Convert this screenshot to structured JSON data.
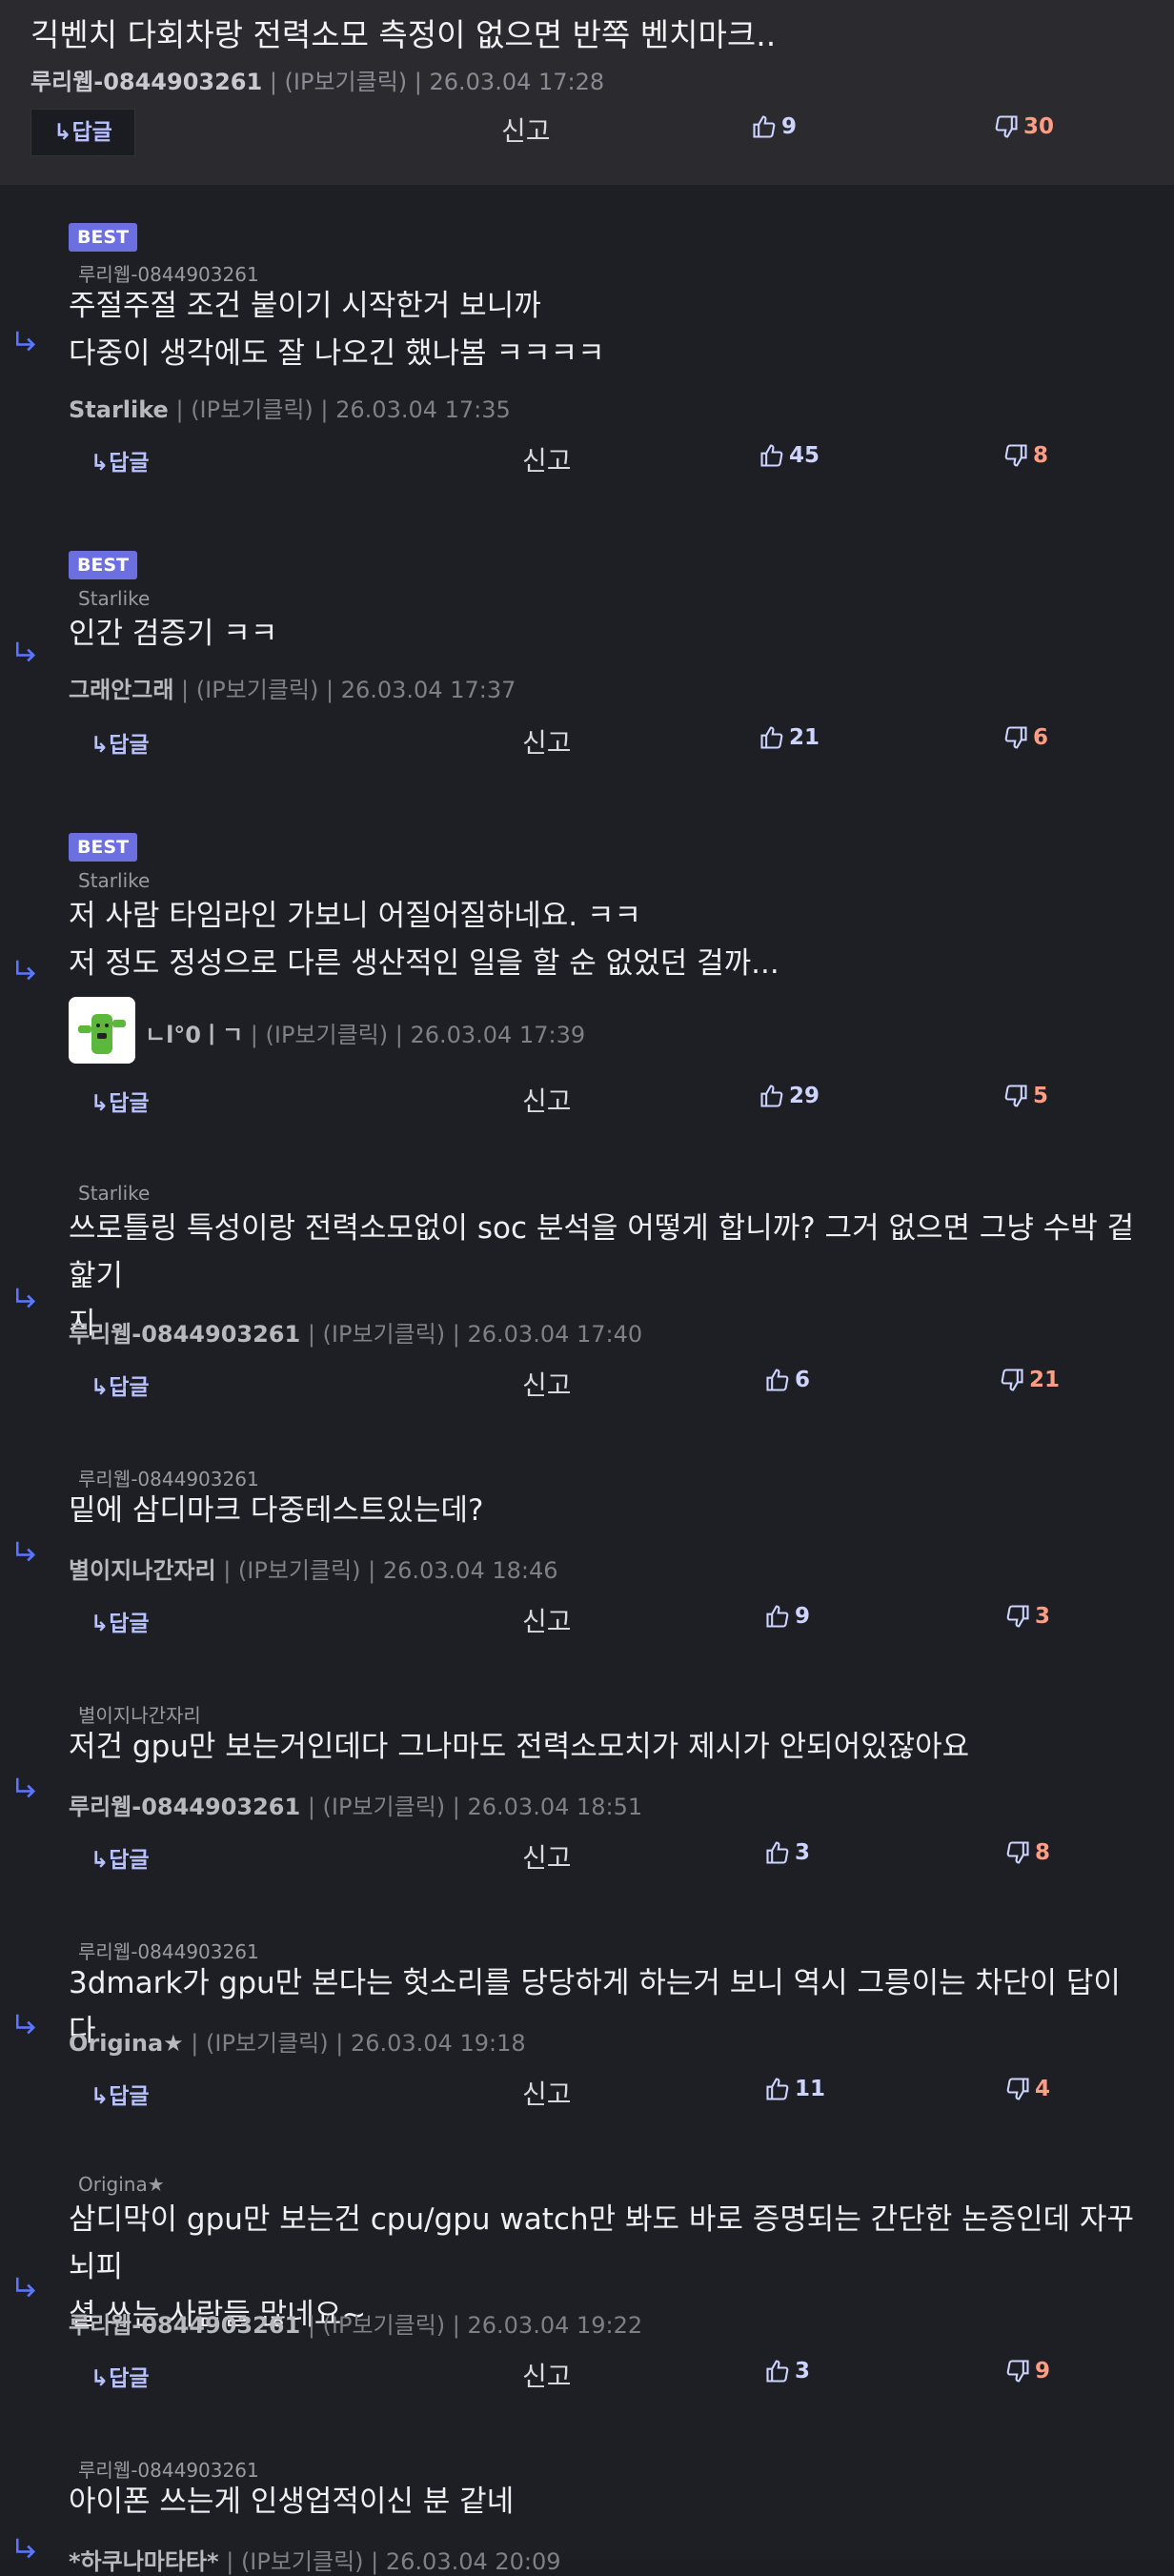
{
  "labels": {
    "reply": "↳답글",
    "report": "신고",
    "best": "BEST"
  },
  "top_comment": {
    "text": "긱벤치 다회차랑 전력소모 측정이 없으면 반쪽 벤치마크..",
    "author": "루리웹-0844903261",
    "meta": " | (IP보기클릭) | 26.03.04 17:28",
    "up": "9",
    "down": "30"
  },
  "comments": [
    {
      "best": true,
      "parent": "루리웹-0844903261",
      "lines": [
        "주절주절 조건 붙이기 시작한거 보니까",
        "다중이 생각에도 잘 나오긴 했나봄 ㅋㅋㅋㅋ"
      ],
      "author": "Starlike",
      "meta": " | (IP보기클릭) | 26.03.04 17:35",
      "up": "45",
      "down": "8"
    },
    {
      "best": true,
      "parent": "Starlike",
      "lines": [
        "인간 검증기 ㅋㅋ"
      ],
      "author": "그래안그래",
      "meta": " | (IP보기클릭) | 26.03.04 17:37",
      "up": "21",
      "down": "6"
    },
    {
      "best": true,
      "parent": "Starlike",
      "lines": [
        "저 사람 타임라인 가보니 어질어질하네요. ㅋㅋ",
        "저 정도 정성으로 다른 생산적인 일을 할 순 없었던 걸까..."
      ],
      "author": "ㄴl°0ㅣㄱ",
      "meta": " | (IP보기클릭) | 26.03.04 17:39",
      "up": "29",
      "down": "5"
    },
    {
      "best": false,
      "parent": "Starlike",
      "lines": [
        "쓰로틀링 특성이랑 전력소모없이 soc 분석을 어떻게 합니까? 그거 없으면 그냥 수박 겉핥기",
        "지"
      ],
      "author": "루리웹-0844903261",
      "meta": " | (IP보기클릭) | 26.03.04 17:40",
      "up": "6",
      "down": "21"
    },
    {
      "best": false,
      "parent": "루리웹-0844903261",
      "lines": [
        "밑에 삼디마크 다중테스트있는데?"
      ],
      "author": "별이지나간자리",
      "meta": " | (IP보기클릭) | 26.03.04 18:46",
      "up": "9",
      "down": "3"
    },
    {
      "best": false,
      "parent": "별이지나간자리",
      "lines": [
        "저건 gpu만 보는거인데다 그나마도 전력소모치가 제시가 안되어있잖아요"
      ],
      "author": "루리웹-0844903261",
      "meta": " | (IP보기클릭) | 26.03.04 18:51",
      "up": "3",
      "down": "8"
    },
    {
      "best": false,
      "parent": "루리웹-0844903261",
      "lines": [
        "3dmark가 gpu만 본다는 헛소리를 당당하게 하는거 보니 역시 그릉이는 차단이 답이다"
      ],
      "author": "Origina★",
      "meta": " | (IP보기클릭) | 26.03.04 19:18",
      "up": "11",
      "down": "4"
    },
    {
      "best": false,
      "parent": "Origina★",
      "lines": [
        "삼디막이 gpu만 보는건 cpu/gpu watch만 봐도 바로 증명되는 간단한 논증인데 자꾸 뇌피",
        "셜 쓰는 사람들 많네요~"
      ],
      "author": "루리웹-0844903261",
      "meta": " | (IP보기클릭) | 26.03.04 19:22",
      "up": "3",
      "down": "9"
    },
    {
      "best": false,
      "parent": "루리웹-0844903261",
      "lines": [
        "아이폰 쓰는게 인생업적이신 분 같네"
      ],
      "author": "*하쿠나마타타*",
      "meta": " | (IP보기클릭) | 26.03.04 20:09",
      "up": "",
      "down": ""
    }
  ]
}
